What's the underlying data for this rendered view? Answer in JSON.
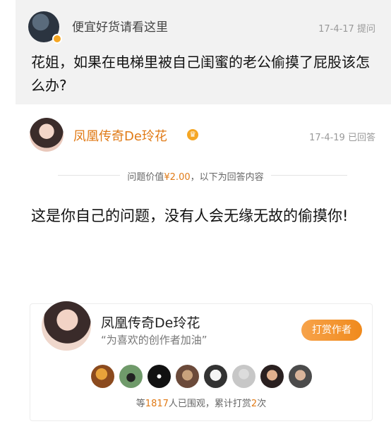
{
  "question": {
    "asker": "便宜好货请看这里",
    "date": "17-4-17",
    "status": "提问",
    "text": "花姐，如果在电梯里被自己闺蜜的老公偷摸了屁股该怎么办?"
  },
  "answer": {
    "answerer": "凤凰传奇De玲花",
    "date": "17-4-19",
    "status": "已回答",
    "price_prefix": "问题价值",
    "price_value": "¥2.00",
    "price_suffix": "，以下为回答内容",
    "text": "这是你自己的问题，没有人会无缘无故的偷摸你!"
  },
  "card": {
    "name": "凤凰传奇De玲花",
    "slogan": "“为喜欢的创作者加油”",
    "tip_button": "打赏作者",
    "stats_prefix": "等",
    "viewer_count": "1817",
    "stats_mid": "人已围观，累计打赏",
    "tip_count": "2",
    "stats_suffix": "次"
  },
  "colors": {
    "accent": "#e07a16",
    "question_bg": "#f2f2f2",
    "tip_button": "#f08a1c"
  }
}
